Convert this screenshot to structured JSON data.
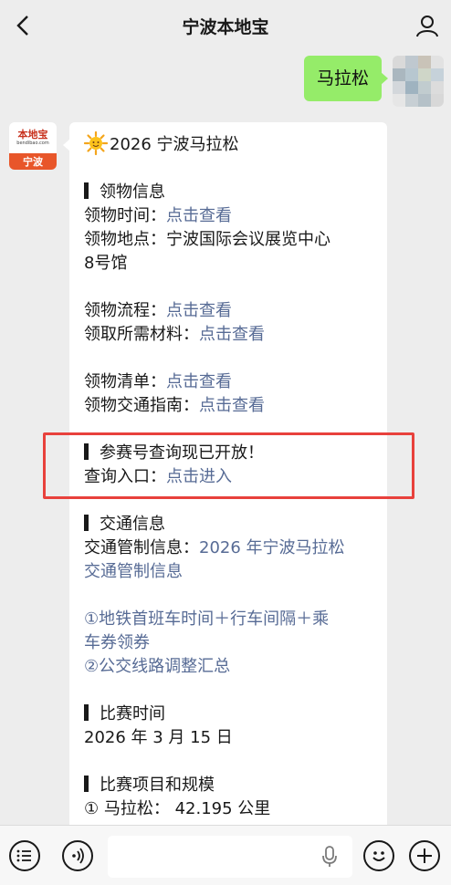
{
  "header": {
    "title": "宁波本地宝",
    "back_icon": "chevron-left-icon",
    "profile_icon": "person-icon"
  },
  "outgoing": {
    "text": "马拉松"
  },
  "account": {
    "logo_name": "本地宝",
    "logo_domain": "bendibao.com",
    "logo_city": "宁波"
  },
  "article": {
    "title_icon": "sun-emoji-icon",
    "title": "2026 宁波马拉松",
    "section1": {
      "heading": "领物信息",
      "time_label": "领物时间：",
      "time_link": "点击查看",
      "place_label": "领物地点：",
      "place_value": "宁波国际会议展览中心",
      "place_value2": "8号馆",
      "process_label": "领物流程：",
      "process_link": "点击查看",
      "materials_label": "领取所需材料：",
      "materials_link": "点击查看",
      "list_label": "领物清单：",
      "list_link": "点击查看",
      "traffic_label": "领物交通指南：",
      "traffic_link": "点击查看"
    },
    "section2": {
      "heading": "参赛号查询现已开放！",
      "query_label": "查询入口：",
      "query_link": "点击进入"
    },
    "section3": {
      "heading": "交通信息",
      "control_label": "交通管制信息：",
      "control_link1": "2026 年宁波马拉松",
      "control_link2": "交通管制信息",
      "metro_link1": "①地铁首班车时间＋行车间隔＋乘",
      "metro_link2": "车券领券",
      "bus_link": "②公交线路调整汇总"
    },
    "section4": {
      "heading": "比赛时间",
      "date": "2026 年 3 月 15 日"
    },
    "section5": {
      "heading": "比赛项目和规模",
      "item1": "① 马拉松： 42.195 公里"
    }
  },
  "input_bar": {
    "menu_icon": "menu-list-icon",
    "voice_icon": "voice-icon",
    "mic_icon": "microphone-icon",
    "emoji_icon": "emoji-icon",
    "plus_icon": "plus-icon"
  },
  "colors": {
    "link": "#576b95",
    "outgoing_bubble": "#95ec69",
    "highlight_border": "#e8413c",
    "background": "#ededed"
  }
}
